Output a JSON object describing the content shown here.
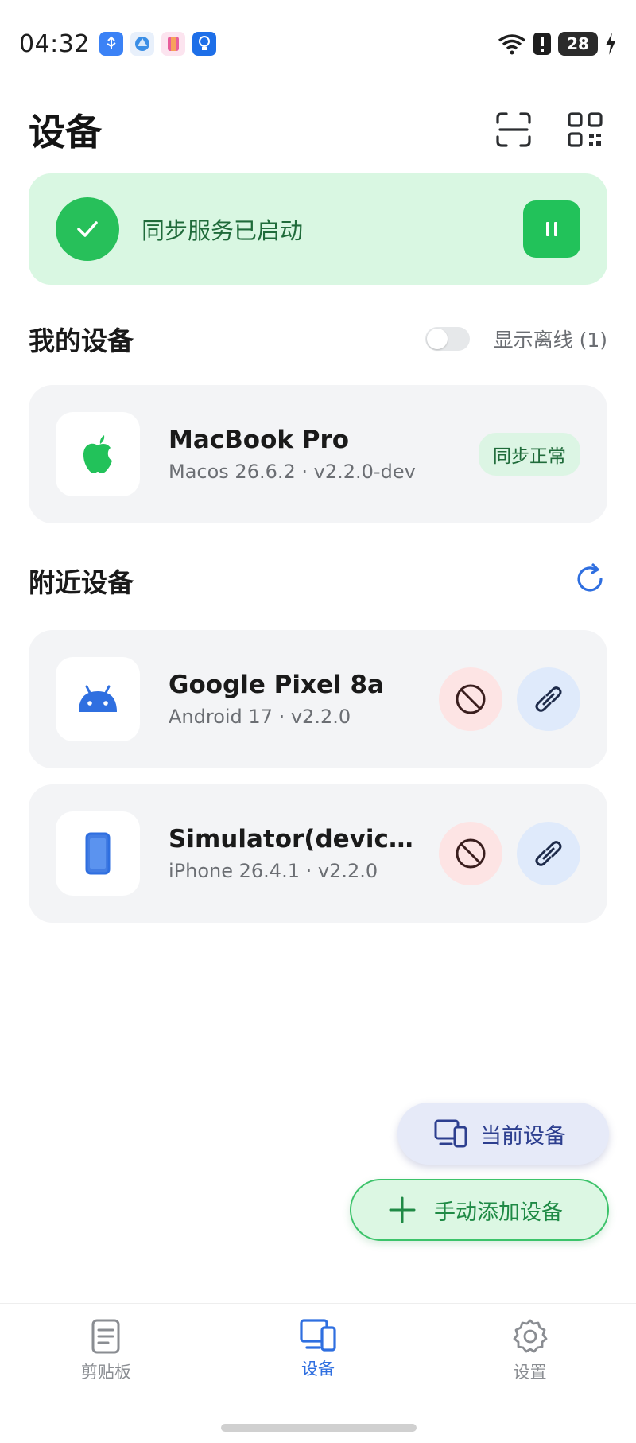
{
  "status_bar": {
    "time": "04:32",
    "battery": "28",
    "notification_icons": [
      "usb-icon",
      "network-icon",
      "app-icon",
      "lightbulb-icon"
    ],
    "right_icons": [
      "wifi-icon",
      "alert-icon",
      "battery-icon",
      "charging-icon"
    ]
  },
  "header": {
    "title": "设备",
    "actions": [
      "scan-icon",
      "qr-code-icon"
    ]
  },
  "sync_banner": {
    "text": "同步服务已启动",
    "icon": "check-icon",
    "action": "pause-icon",
    "color": "#27c05a"
  },
  "my_devices": {
    "title": "我的设备",
    "toggle_label": "显示离线 (1)",
    "toggle_on": false,
    "devices": [
      {
        "name": "MacBook Pro",
        "meta": "Macos 26.6.2 · v2.2.0-dev",
        "status": "同步正常",
        "icon": "apple-icon"
      }
    ]
  },
  "nearby_devices": {
    "title": "附近设备",
    "refresh_icon": "refresh-icon",
    "devices": [
      {
        "name": "Google Pixel 8a",
        "meta": "Android 17 · v2.2.0",
        "icon": "android-icon"
      },
      {
        "name": "Simulator(device...",
        "meta": "iPhone 26.4.1 · v2.2.0",
        "icon": "phone-icon"
      }
    ]
  },
  "fabs": {
    "current_device": "当前设备",
    "add_device": "手动添加设备"
  },
  "bottom_nav": {
    "items": [
      {
        "label": "剪贴板",
        "icon": "clipboard-icon",
        "active": false
      },
      {
        "label": "设备",
        "icon": "devices-icon",
        "active": true
      },
      {
        "label": "设置",
        "icon": "gear-icon",
        "active": false
      }
    ]
  },
  "colors": {
    "accent_blue": "#2f6fe0",
    "success_green": "#22c25a",
    "danger_red": "#c0392b"
  }
}
